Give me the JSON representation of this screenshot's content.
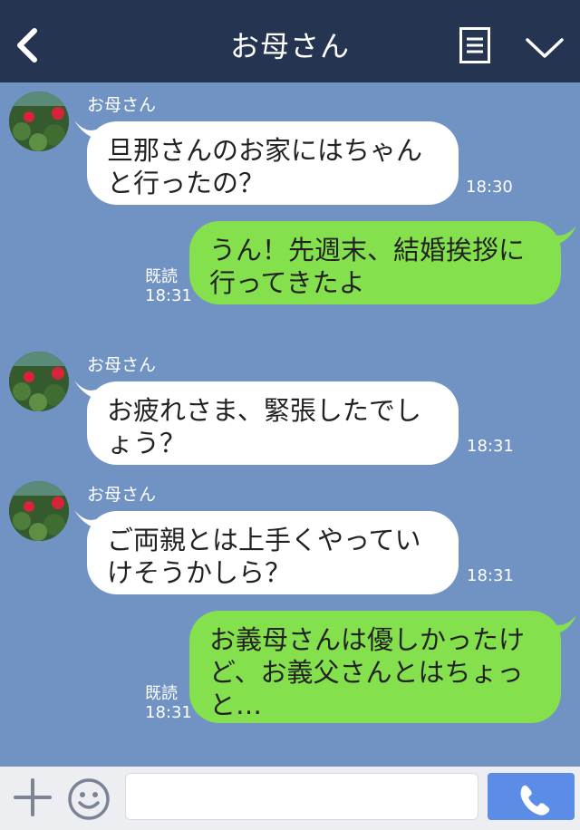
{
  "header": {
    "title": "お母さん"
  },
  "messages": [
    {
      "sender": "お母さん",
      "line1": "旦那さんのお家にはちゃん",
      "line2": "と行ったの？",
      "time": "18:30"
    },
    {
      "line1": "うん！先週末、結婚挨拶に",
      "line2": "行ってきたよ",
      "read": "既読",
      "time": "18:31"
    },
    {
      "sender": "お母さん",
      "line1": "お疲れさま、緊張したでし",
      "line2": "ょう？",
      "time": "18:31"
    },
    {
      "sender": "お母さん",
      "line1": "ご両親とは上手くやってい",
      "line2": "けそうかしら？",
      "time": "18:31"
    },
    {
      "line1": "お義母さんは優しかったけ",
      "line2": "ど、お義父さんとはちょっ",
      "line3": "と…",
      "read": "既読",
      "time": "18:31"
    }
  ],
  "composer": {
    "placeholder": ""
  },
  "colors": {
    "header": "#253450",
    "background": "#7093c4",
    "incoming": "#ffffff",
    "outgoing": "#84e04c",
    "call_button": "#5b8de6"
  },
  "icons": {
    "back": "chevron-left-icon",
    "menu": "menu-icon",
    "collapse": "chevron-down-icon",
    "add": "plus-icon",
    "emoji": "smiley-icon",
    "call": "phone-icon"
  }
}
